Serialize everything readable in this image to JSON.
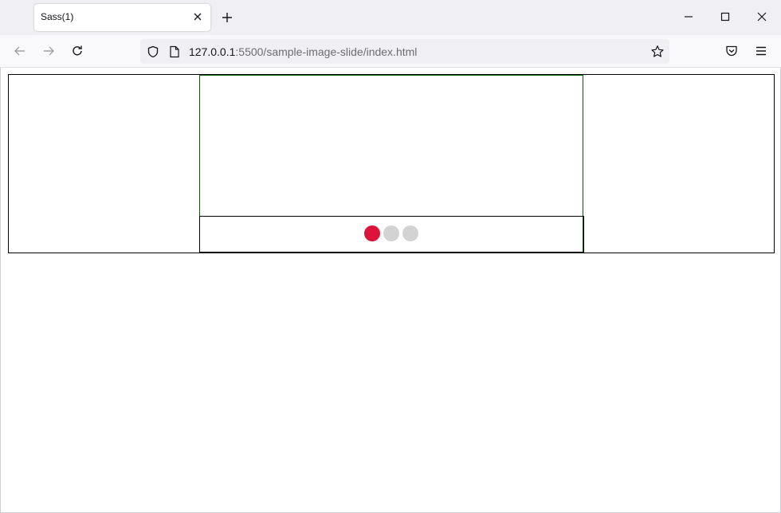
{
  "browser": {
    "tab": {
      "title": "Sass(1)"
    },
    "url": {
      "host": "127.0.0.1",
      "rest": ":5500/sample-image-slide/index.html"
    }
  },
  "page": {
    "indicator_dots": [
      {
        "label": "slide 1",
        "active": true,
        "color": "#dc143c"
      },
      {
        "label": "slide 2",
        "active": false,
        "color": "#d3d3d3"
      },
      {
        "label": "slide 3",
        "active": false,
        "color": "#d3d3d3"
      }
    ]
  },
  "colors": {
    "frame_border": "#006400",
    "active_dot": "#dc143c",
    "inactive_dot": "#d3d3d3"
  }
}
